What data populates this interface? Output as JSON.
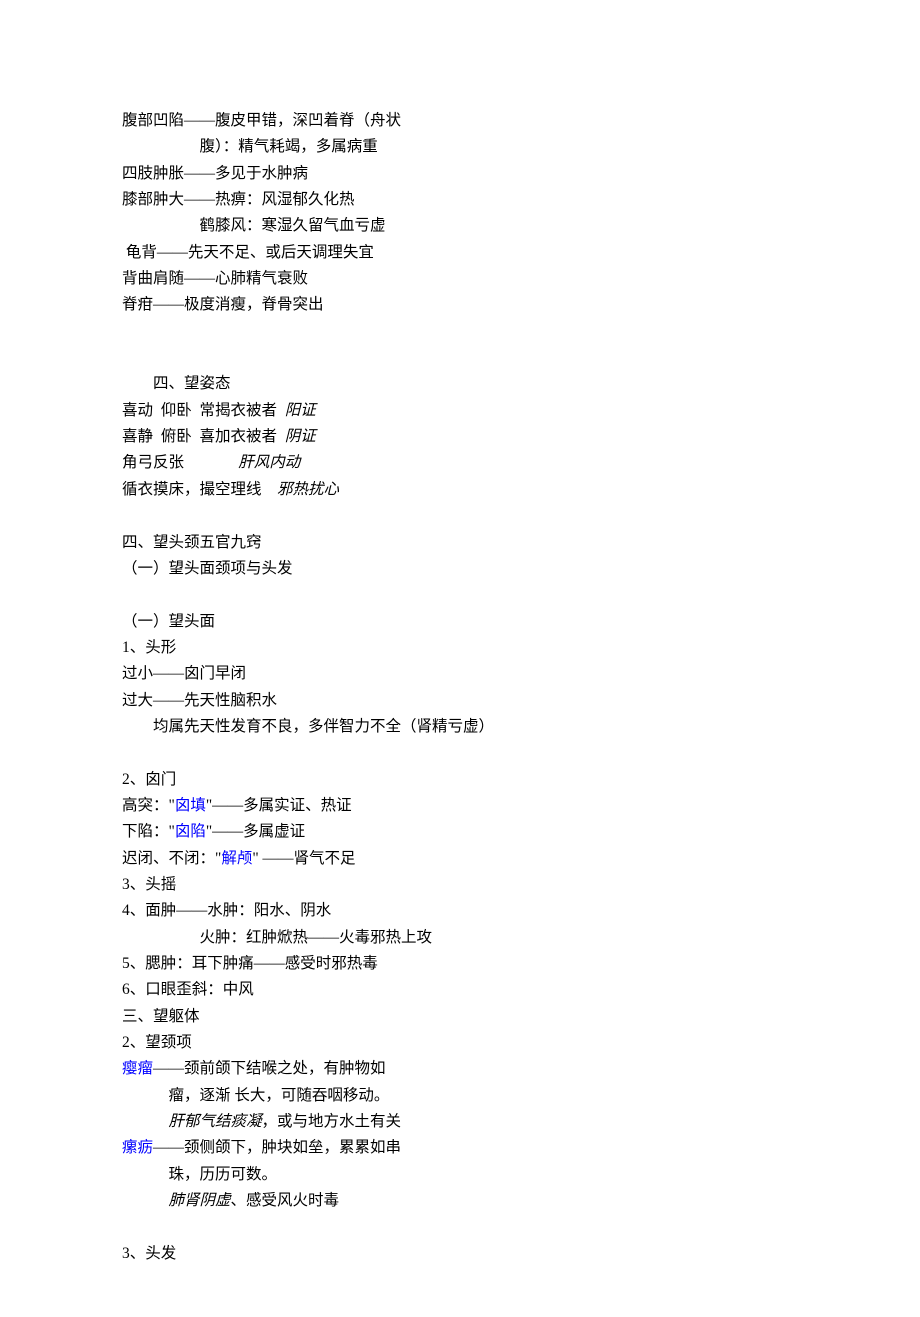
{
  "block1": {
    "l1a": "腹部凹陷——腹皮甲错，深凹着脊（舟状",
    "l1b": "腹）：精气耗竭，多属病重",
    "l2": "四肢肿胀——多见于水肿病",
    "l3a": "膝部肿大——热痹：风湿郁久化热",
    "l3b": "鹤膝风：寒湿久留气血亏虚",
    "l4": " 龟背——先天不足、或后天调理失宜",
    "l5": "背曲肩随——心肺精气衰败",
    "l6": "脊疳——极度消瘦，脊骨突出"
  },
  "section4": {
    "title": "四、望姿态",
    "row1_c1": "喜动",
    "row1_c2": "仰卧",
    "row1_c3": "常揭衣被者",
    "row1_c4": "阳证",
    "row2_c1": "喜静",
    "row2_c2": "俯卧",
    "row2_c3": "喜加衣被者",
    "row2_c4": "阴证",
    "row3_c1": "角弓反张",
    "row3_c4": "肝风内动",
    "row4_c1": "循衣摸床，撮空理线",
    "row4_c4": "邪热扰心"
  },
  "section5": {
    "h1": "四、望头颈五官九窍",
    "h2": "（一）望头面颈项与头发"
  },
  "headface": {
    "h": "（一）望头面",
    "p1_h": "1、头形",
    "p1_l1": "过小——囟门早闭",
    "p1_l2": "过大——先天性脑积水",
    "p1_l3": "均属先天性发育不良，多伴智力不全（肾精亏虚）"
  },
  "p2": {
    "h": "2、囟门",
    "l1_a": "高突：\"",
    "l1_link": "囟填",
    "l1_b": "\"——多属实证、热证",
    "l2_a": "下陷：\"",
    "l2_link": "囟陷",
    "l2_b": "\"——多属虚证",
    "l3_a": "迟闭、不闭：\"",
    "l3_link": "解颅",
    "l3_b": "\" ——肾气不足"
  },
  "p3": {
    "h": "3、头摇"
  },
  "p4": {
    "h": "4、面肿——水肿：阳水、阴水",
    "l2": "火肿：红肿焮热——火毒邪热上攻"
  },
  "p5": {
    "h": "5、腮肿：耳下肿痛——感受时邪热毒"
  },
  "p6": {
    "h": "6、口眼歪斜：中风"
  },
  "trunk": {
    "h": "三、望躯体"
  },
  "neck": {
    "h": "2、望颈项",
    "t1_link": "瘿瘤",
    "t1_a": "——颈前颌下结喉之处，有肿物如",
    "t1_b": "瘤，逐渐 长大，可随吞咽移动。",
    "t1_c_i": "肝郁气结痰凝",
    "t1_c": "，或与地方水土有关",
    "t2_link": "瘰疬",
    "t2_a": "——颈侧颌下，肿块如垒，累累如串",
    "t2_b": "珠，历历可数。",
    "t2_c_i": "肺肾阴虚",
    "t2_c": "、感受风火时毒"
  },
  "hair": {
    "h": "3、头发"
  }
}
